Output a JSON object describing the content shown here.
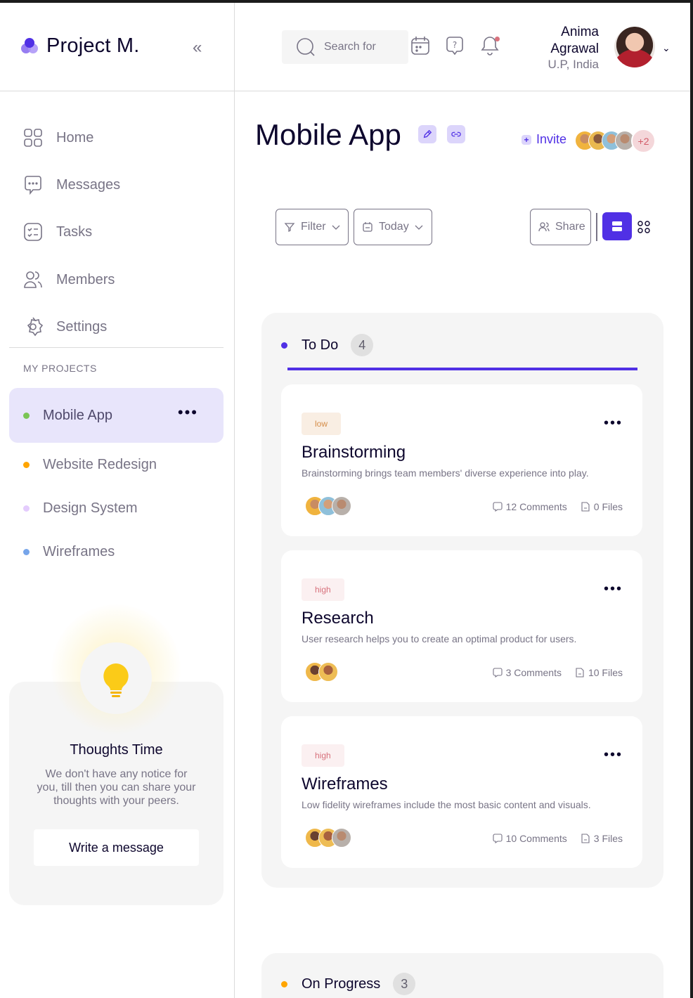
{
  "app": {
    "name": "Project M."
  },
  "nav": [
    {
      "label": "Home",
      "icon": "grid-icon"
    },
    {
      "label": "Messages",
      "icon": "message-icon"
    },
    {
      "label": "Tasks",
      "icon": "task-icon"
    },
    {
      "label": "Members",
      "icon": "members-icon"
    },
    {
      "label": "Settings",
      "icon": "gear-icon"
    }
  ],
  "projects": {
    "heading": "MY PROJECTS",
    "items": [
      {
        "label": "Mobile App",
        "color": "#7ac555",
        "active": true
      },
      {
        "label": "Website Redesign",
        "color": "#ffa500"
      },
      {
        "label": "Design System",
        "color": "#e4ccfd"
      },
      {
        "label": "Wireframes",
        "color": "#76a5ea"
      }
    ]
  },
  "thoughts": {
    "title": "Thoughts Time",
    "text": "We don't have any notice for you, till then you can share your thoughts with your peers.",
    "button": "Write a message"
  },
  "header": {
    "search_placeholder": "Search for",
    "user": {
      "first_name": "Anima",
      "last_name": "Agrawal",
      "location": "U.P, India"
    }
  },
  "main": {
    "title": "Mobile App",
    "invite_label": "Invite",
    "extra_members": "+2",
    "toolbar": {
      "filter": "Filter",
      "today": "Today",
      "share": "Share"
    }
  },
  "columns": [
    {
      "title": "To Do",
      "count": "4",
      "color": "#5030e5",
      "cards": [
        {
          "priority": "low",
          "title": "Brainstorming",
          "description": "Brainstorming brings team members' diverse experience into play.",
          "comments": "12 Comments",
          "files": "0 Files"
        },
        {
          "priority": "high",
          "title": "Research",
          "description": "User research helps you to create an optimal product for users.",
          "comments": "3 Comments",
          "files": "10 Files"
        },
        {
          "priority": "high",
          "title": "Wireframes",
          "description": "Low fidelity wireframes include the most basic content and visuals.",
          "comments": "10 Comments",
          "files": "3 Files"
        }
      ]
    },
    {
      "title": "On Progress",
      "count": "3",
      "color": "#ffa500",
      "cards": []
    }
  ]
}
